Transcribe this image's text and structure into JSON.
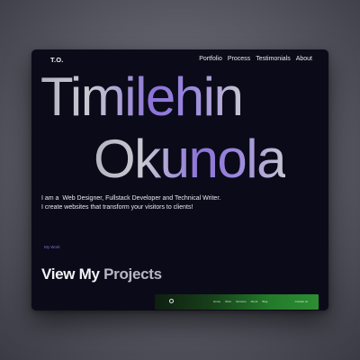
{
  "nav": {
    "logo": "T.O.",
    "items": [
      {
        "label": "Portfolio"
      },
      {
        "label": "Process"
      },
      {
        "label": "Testimonials"
      },
      {
        "label": "About"
      }
    ]
  },
  "hero": {
    "first_name": "Timilehin",
    "last_name": "Okunola",
    "intro_line1": "I am a  Web Designer, Fullstack Developer and Technical Writer.",
    "intro_line2": "I create websites that transform your visitors to clients!"
  },
  "work": {
    "link_label": "My Work",
    "heading_word1": "View My",
    "heading_word2": "Projects"
  },
  "thumbnail": {
    "menu": [
      {
        "label": "Home"
      },
      {
        "label": "Work"
      },
      {
        "label": "Services"
      },
      {
        "label": "About"
      },
      {
        "label": "Blog"
      }
    ],
    "cta": "Contact us"
  },
  "colors": {
    "page_background": "#0b0a18",
    "accent_purple": "#8b73d8",
    "thumbnail_green": "#2c8e32"
  }
}
